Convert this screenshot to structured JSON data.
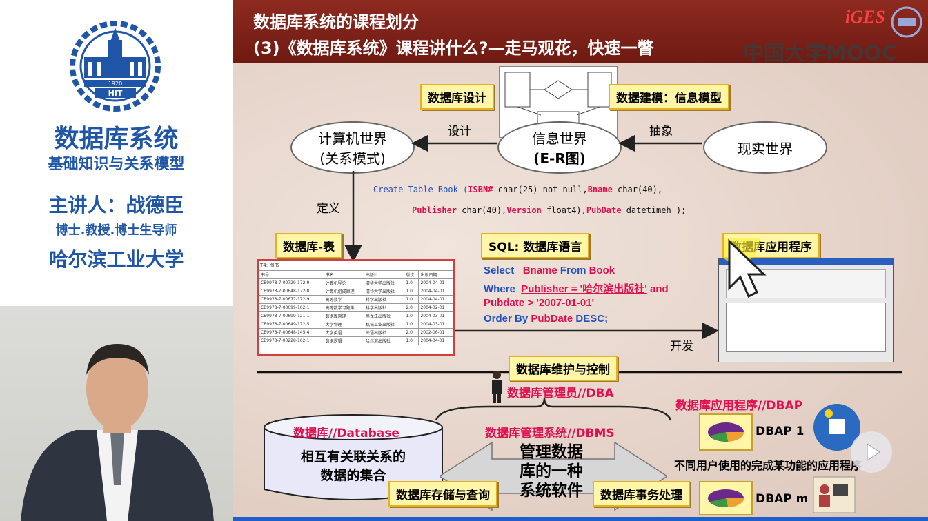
{
  "course": {
    "logo_year": "1920",
    "logo_letters": "HIT",
    "title": "数据库系统",
    "subtitle": "基础知识与关系模型",
    "lecturer": "主讲人：战德臣",
    "lecturer_title": "博士.教授.博士生导师",
    "university": "哈尔滨工业大学"
  },
  "slide": {
    "header_line1": "数据库系统的课程划分",
    "header_line2": "(3)《数据库系统》课程讲什么?—走马观花，快速一瞥",
    "watermark": "中国大学MOOC",
    "top_logo": "iGES",
    "db_design": "数据库设计",
    "db_modeling": "数据建模：信息模型",
    "computer_world_1": "计算机世界",
    "computer_world_2": "(关系模式)",
    "info_world_1": "信息世界",
    "info_world_2": "(E-R图)",
    "real_world": "现实世界",
    "design": "设计",
    "abstract": "抽象",
    "define": "定义",
    "create_1a": "Create Table Book (",
    "create_1b": "ISBN#",
    "create_1c": " char(25) not null,",
    "create_1d": "Bname",
    "create_1e": " char(40),",
    "create_2a": "Publisher",
    "create_2b": " char(40),",
    "create_2c": "Version",
    "create_2d": " float4),",
    "create_2e": "PubDate",
    "create_2f": " datetimeh );",
    "db_table": "数据库-表",
    "sql_lang": "SQL: 数据库语言",
    "db_app": "数据库应用程序",
    "q_select": "Select",
    "q_bname": "Bname",
    "q_from": "From",
    "q_book": "Book",
    "q_where": "Where",
    "q_publisher": "Publisher = '哈尔滨出版社'",
    "q_and": "and",
    "q_pubdate": "Pubdate > '2007-01-01'",
    "q_order": "Order By",
    "q_pubdate2": "PubDate",
    "q_desc": "DESC;",
    "develop": "开发",
    "db_maint": "数据库维护与控制",
    "dba": "数据库管理员//DBA",
    "dbap": "数据库应用程序//DBAP",
    "database": "数据库//Database",
    "dbms": "数据库管理系统//DBMS",
    "data_set_1": "相互有关联关系的",
    "data_set_2": "数据的集合",
    "dbms_desc_1": "管理数据",
    "dbms_desc_2": "库的一种",
    "dbms_desc_3": "系统软件",
    "dbap1": "DBAP 1",
    "dbapm": "DBAP m",
    "diff_users": "不同用户使用的完成某功能的应用程序",
    "storage": "数据库存储与查询",
    "transaction": "数据库事务处理"
  },
  "table_preview": {
    "title": "T4: 图书",
    "headers": [
      "书号",
      "书名",
      "出版社",
      "版次",
      "出版日期"
    ],
    "rows": [
      [
        "CB9978-7-00729-172-9",
        "计算机导论",
        "清华大学出版社",
        "1.0",
        "2004-04-01"
      ],
      [
        "CB9978-7-00648-172-0",
        "计算机组成原理",
        "清华大学出版社",
        "1.0",
        "2004-04-01"
      ],
      [
        "CB9978-7-00677-172-9",
        "高等数学",
        "科学出版社",
        "1.0",
        "2004-04-01"
      ],
      [
        "CB9978-7-00699-162-1",
        "高等数学习题集",
        "科学出版社",
        "2.0",
        "2004-02-01"
      ],
      [
        "CB9978-7-00699-121-1",
        "数据库原理",
        "黑龙江出版社",
        "1.0",
        "2004-03-01"
      ],
      [
        "CB9978-7-00649-172-5",
        "大学物理",
        "机械工业出版社",
        "1.0",
        "2004-03-01"
      ],
      [
        "CB9978-7-00648-145-4",
        "大学英语",
        "外语出版社",
        "2.0",
        "2002-06-01"
      ],
      [
        "CB9978-7-00228-162-1",
        "数据逻辑",
        "哈尔滨出版社",
        "1.0",
        "2004-04-01"
      ]
    ]
  }
}
